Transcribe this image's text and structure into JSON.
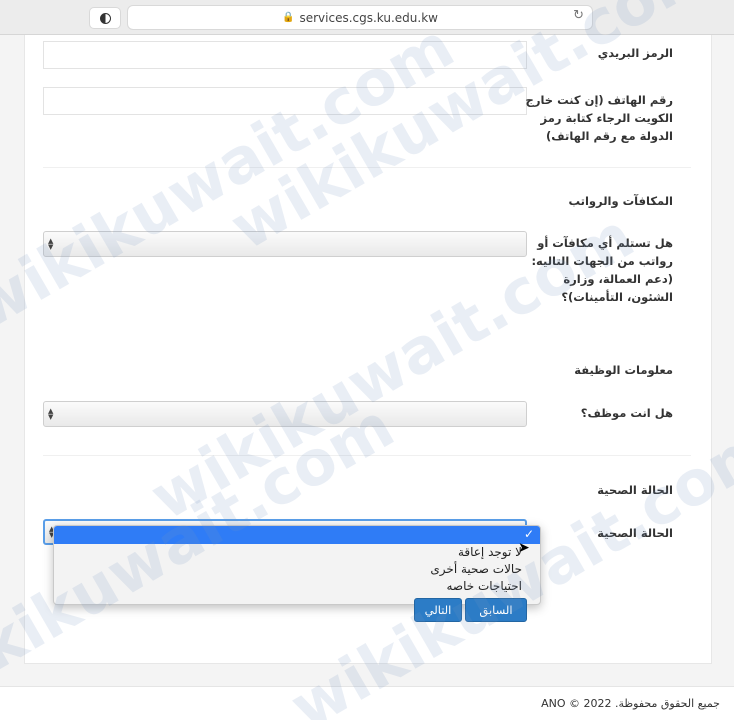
{
  "browser": {
    "url": "services.cgs.ku.edu.kw"
  },
  "form": {
    "postal_code_label": "الرمز البريدي",
    "phone_label": "رقم الهاتف (إن كنت خارج الكويت الرجاء كتابة رمز الدولة مع رقم الهاتف)",
    "rewards_section": "المكافآت والرواتب",
    "rewards_question": "هل تستلم أي مكافآت أو رواتب من الجهات التاليه: (دعم العمالة، وزارة الشئون، التأمينات)؟",
    "job_section": "معلومات الوظيفة",
    "employed_question": "هل انت موظف؟",
    "health_section": "الحالة الصحية",
    "health_label": "الحالة الصحية"
  },
  "dropdown": {
    "options": [
      "لا توجد إعاقة",
      "حالات صحية أخرى",
      "احتياجات خاصه"
    ]
  },
  "buttons": {
    "previous": "السابق",
    "next": "التالي"
  },
  "footer": {
    "copyright": "جميع الحقوق محفوظة. 2022 © ANO"
  },
  "watermark": {
    "text": "wikikuwait.com"
  }
}
